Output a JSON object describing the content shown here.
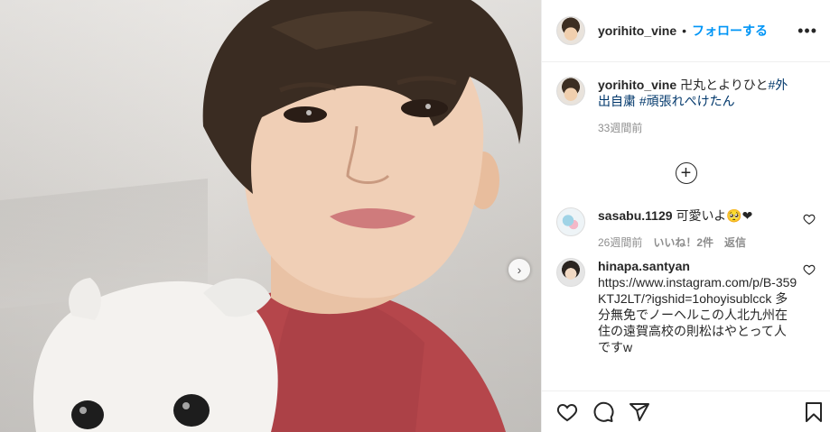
{
  "post": {
    "author": "yorihito_vine",
    "follow_label": "フォローする",
    "separator": "•",
    "more_label": "•••",
    "carousel_next": "›"
  },
  "caption": {
    "user": "yorihito_vine",
    "text_plain": "卍丸とよりひと",
    "tag1": "#外出自粛",
    "tag2": "#頑張れぺけたん",
    "time": "33週間前"
  },
  "load_more": "+",
  "comments": [
    {
      "user": "sasabu.1129",
      "text": "可愛いよ🥺❤",
      "time": "26週間前",
      "likes": "いいね！2件",
      "reply": "返信"
    },
    {
      "user": "hinapa.santyan",
      "text": "https://www.instagram.com/p/B-359KTJ2LT/?igshid=1ohoyisublcck 多分無免でノーヘルこの人北九州在住の遠賀高校の則松はやとって人ですw"
    }
  ],
  "actions": {
    "icons": [
      "heart-icon",
      "comment-icon",
      "share-icon",
      "bookmark-icon"
    ]
  },
  "colors": {
    "accent": "#0095f6",
    "text": "#262626",
    "muted": "#8e8e8e",
    "shirt": "#b5464b",
    "hair": "#3a2c22",
    "skin": "#efcdb4"
  }
}
